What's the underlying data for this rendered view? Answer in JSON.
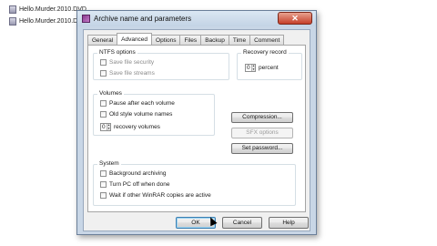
{
  "background_files": [
    {
      "name": "Hello.Murder.2010.DVD"
    },
    {
      "name": "Hello.Murder.2010.DVD"
    }
  ],
  "dialog": {
    "title": "Archive name and parameters",
    "close_glyph": "✕"
  },
  "tabs": [
    {
      "label": "General"
    },
    {
      "label": "Advanced",
      "active": true
    },
    {
      "label": "Options"
    },
    {
      "label": "Files"
    },
    {
      "label": "Backup"
    },
    {
      "label": "Time"
    },
    {
      "label": "Comment"
    }
  ],
  "ntfs": {
    "title": "NTFS options",
    "options": [
      {
        "label": "Save file security",
        "checked": false
      },
      {
        "label": "Save file streams",
        "checked": false
      }
    ]
  },
  "recovery": {
    "title": "Recovery record",
    "value": "0",
    "unit": "percent"
  },
  "volumes": {
    "title": "Volumes",
    "options": [
      {
        "label": "Pause after each volume",
        "checked": false
      },
      {
        "label": "Old style volume names",
        "checked": false
      }
    ],
    "recovery_count": "0",
    "recovery_label": "recovery volumes"
  },
  "side_buttons": {
    "compression": "Compression...",
    "sfx": "SFX options",
    "password": "Set password..."
  },
  "system": {
    "title": "System",
    "options": [
      {
        "label": "Background archiving",
        "checked": false
      },
      {
        "label": "Turn PC off when done",
        "checked": false
      },
      {
        "label": "Wait if other WinRAR copies are active",
        "checked": false
      }
    ]
  },
  "footer": {
    "ok": "OK",
    "cancel": "Cancel",
    "help": "Help"
  },
  "colors": {
    "frame": "#c8d6e6",
    "close": "#c6402a",
    "default_button_border": "#3c7fb1"
  }
}
